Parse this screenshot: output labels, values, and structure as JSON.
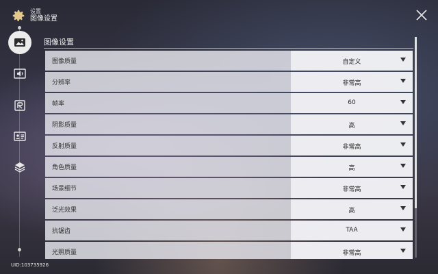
{
  "header": {
    "small_title": "设置",
    "title": "图像设置"
  },
  "section": {
    "title": "图像设置"
  },
  "rows": [
    {
      "label": "图像质量",
      "value": "自定义"
    },
    {
      "label": "分辨率",
      "value": "非常高"
    },
    {
      "label": "帧率",
      "value": "60"
    },
    {
      "label": "阴影质量",
      "value": "高"
    },
    {
      "label": "反射质量",
      "value": "非常高"
    },
    {
      "label": "角色质量",
      "value": "高"
    },
    {
      "label": "场景细节",
      "value": "非常高"
    },
    {
      "label": "泛光效果",
      "value": "高"
    },
    {
      "label": "抗锯齿",
      "value": "TAA"
    },
    {
      "label": "光照质量",
      "value": "非常高"
    }
  ],
  "uid": "UID:103735926",
  "colors": {
    "accent": "#e3c98c",
    "row_bg": "#e1e1e8",
    "text": "#333333"
  },
  "icons": [
    "gear-icon",
    "close-icon",
    "image-icon",
    "sound-icon",
    "language-icon",
    "account-icon",
    "layers-icon"
  ]
}
